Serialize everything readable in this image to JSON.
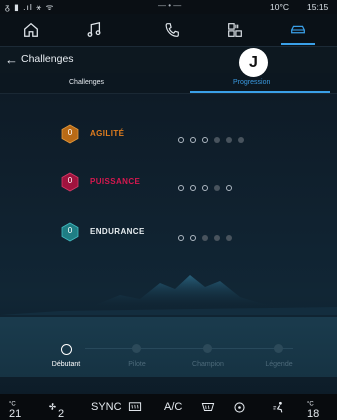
{
  "status": {
    "signal": "ᵹ ▮ .ıl ⚹ ᯤ",
    "center": "— • —",
    "temperature": "10°C",
    "time": "15:15"
  },
  "nav": {
    "tabs": [
      "home-icon",
      "music-icon",
      "phone-icon",
      "apps-icon",
      "car-icon"
    ],
    "active": "car-icon"
  },
  "header": {
    "back": "←",
    "title": "Challenges"
  },
  "badge": "J",
  "subtabs": {
    "first": "Challenges",
    "second": "Progression"
  },
  "challenges": [
    {
      "value": "0",
      "name": "AGILITÉ",
      "color": "#e07d1e",
      "dots_filled": 3
    },
    {
      "value": "0",
      "name": "PUISSANCE",
      "color": "#d6184f",
      "dots_filled": 2
    },
    {
      "value": "0",
      "name": "ENDURANCE",
      "color": "#2aa6ad",
      "dots_filled": 3
    }
  ],
  "levels": [
    "Débutant",
    "Pilote",
    "Champion",
    "Légende"
  ],
  "current_level": "Débutant",
  "climate": {
    "left_temp": "21",
    "fan": "2",
    "sync": "SYNC",
    "ac": "A/C",
    "right_temp": "18"
  }
}
